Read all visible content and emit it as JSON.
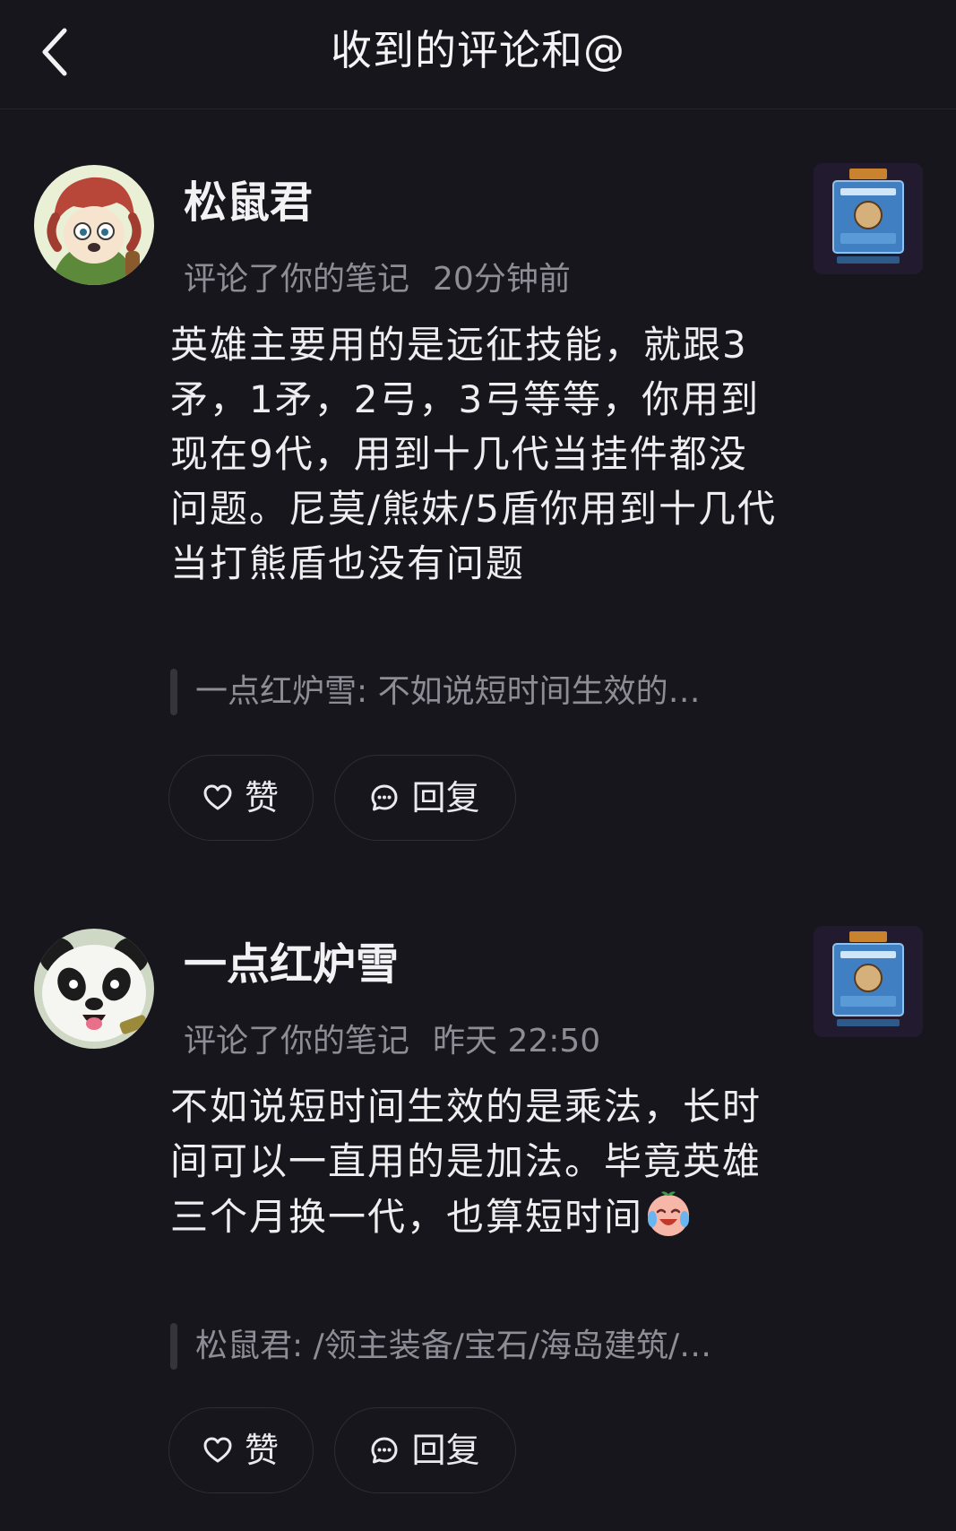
{
  "header": {
    "title": "收到的评论和@",
    "back_icon": "chevron-left-icon"
  },
  "comments": [
    {
      "username": "松鼠君",
      "action": "评论了你的笔记",
      "time": "20分钟前",
      "text": "英雄主要用的是远征技能，就跟3矛，1矛，2弓，3弓等等，你用到现在9代，用到十几代当挂件都没问题。尼莫/熊妹/5盾你用到十几代当打熊盾也没有问题",
      "quote": "一点红炉雪: 不如说短时间生效的…",
      "like_label": "赞",
      "reply_label": "回复",
      "avatar": "cartoon-red-hair-avatar"
    },
    {
      "username": "一点红炉雪",
      "action": "评论了你的笔记",
      "time": "昨天 22:50",
      "text": "不如说短时间生效的是乘法，长时间可以一直用的是加法。毕竟英雄三个月换一代，也算短时间",
      "emoji": "crying-laughing-emoji",
      "quote": "松鼠君: /领主装备/宝石/海岛建筑/…",
      "like_label": "赞",
      "reply_label": "回复",
      "avatar": "panda-avatar"
    }
  ],
  "colors": {
    "background": "#17161c",
    "text_primary": "#f2f2f4",
    "text_secondary": "#8e8d96",
    "divider": "#26252c"
  }
}
